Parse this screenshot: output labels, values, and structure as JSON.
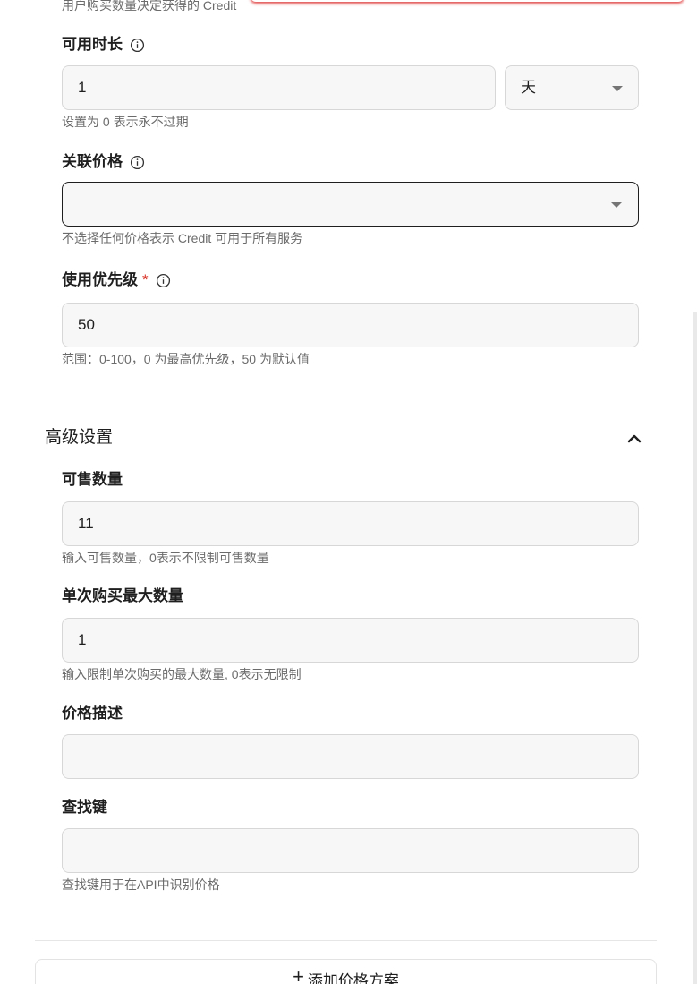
{
  "top_help": "用户购买数量决定获得的 Credit",
  "duration": {
    "label": "可用时长",
    "value": "1",
    "unit": "天",
    "help": "设置为 0 表示永不过期"
  },
  "linked_price": {
    "label": "关联价格",
    "value": "",
    "help": "不选择任何价格表示 Credit 可用于所有服务"
  },
  "priority": {
    "label": "使用优先级",
    "required_mark": "*",
    "value": "50",
    "help": "范围：0-100，0 为最高优先级，50 为默认值"
  },
  "advanced": {
    "title": "高级设置",
    "quantity": {
      "label": "可售数量",
      "value": "11",
      "help": "输入可售数量，0表示不限制可售数量"
    },
    "max_per_purchase": {
      "label": "单次购买最大数量",
      "value": "1",
      "help": "输入限制单次购买的最大数量, 0表示无限制"
    },
    "price_description": {
      "label": "价格描述",
      "value": ""
    },
    "lookup_key": {
      "label": "查找键",
      "value": "",
      "help": "查找键用于在API中识别价格"
    }
  },
  "add_plan_button": {
    "icon": "plus-icon",
    "label": "添加价格方案"
  },
  "colors": {
    "required": "#d93025",
    "field_bg": "#f7f7f7",
    "field_border": "#d7d7d7",
    "help_text": "#6b6b6b"
  }
}
